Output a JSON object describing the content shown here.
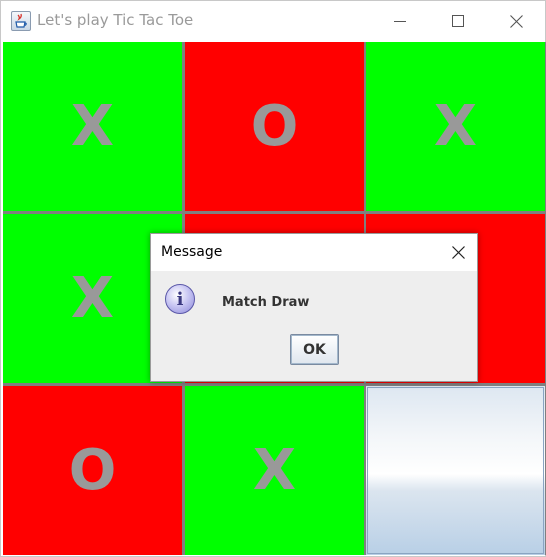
{
  "window": {
    "title": "Let's play Tic Tac Toe",
    "icon": "java-app-icon",
    "controls": [
      "minimize-icon",
      "maximize-icon",
      "close-icon"
    ]
  },
  "board": {
    "cells": [
      {
        "mark": "X",
        "color": "#00ff00"
      },
      {
        "mark": "O",
        "color": "#ff0000"
      },
      {
        "mark": "X",
        "color": "#00ff00"
      },
      {
        "mark": "X",
        "color": "#00ff00"
      },
      {
        "mark": "",
        "color": "#ff0000"
      },
      {
        "mark": "",
        "color": "#ff0000"
      },
      {
        "mark": "O",
        "color": "#ff0000"
      },
      {
        "mark": "X",
        "color": "#00ff00"
      },
      {
        "mark": "",
        "color": "#e6eef6"
      }
    ],
    "mark_color": "#999999"
  },
  "dialog": {
    "title": "Message",
    "icon": "info-icon",
    "icon_glyph": "i",
    "message": "Match Draw",
    "ok_label": "OK"
  }
}
